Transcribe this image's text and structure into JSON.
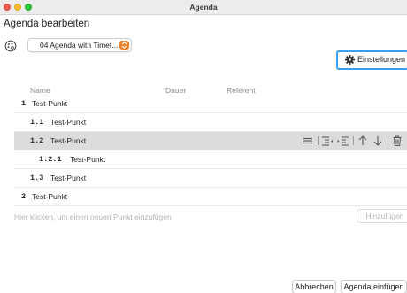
{
  "window": {
    "title": "Agenda"
  },
  "heading": "Agenda bearbeiten",
  "template_select": {
    "value": "04 Agenda with Timet...",
    "icon": "palette-icon"
  },
  "settings_button": {
    "label": "Einstellungen",
    "icon": "gear-icon"
  },
  "columns": {
    "name": "Name",
    "dauer": "Dauer",
    "referent": "Referent"
  },
  "rows": [
    {
      "number": "1",
      "label": "Test-Punkt",
      "selected": false
    },
    {
      "number": "1.1",
      "label": "Test-Punkt",
      "selected": false
    },
    {
      "number": "1.2",
      "label": "Test-Punkt",
      "selected": true
    },
    {
      "number": "1.2.1",
      "label": "Test-Punkt",
      "selected": false
    },
    {
      "number": "1.3",
      "label": "Test-Punkt",
      "selected": false
    },
    {
      "number": "2",
      "label": "Test-Punkt",
      "selected": false
    }
  ],
  "row_tools": [
    "drag-handle-icon",
    "outdent-icon",
    "indent-icon",
    "move-up-icon",
    "move-down-icon",
    "trash-icon"
  ],
  "insert": {
    "placeholder": "Hier klicken, um einen neuen Punkt einzufügen",
    "button_label": "Hinzufügen"
  },
  "footer": {
    "cancel_label": "Abbrechen",
    "confirm_label": "Agenda einfügen"
  },
  "colors": {
    "selection": "#dcdcdc",
    "focus_ring": "#3a9ef2",
    "stepper": "#f0812c"
  }
}
